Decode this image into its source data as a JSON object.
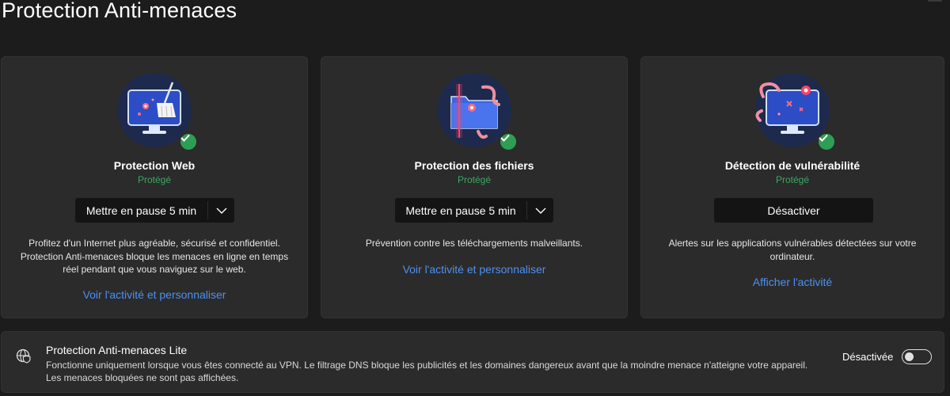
{
  "page": {
    "title": "Protection Anti-menaces"
  },
  "cards": [
    {
      "title": "Protection Web",
      "status": "Protégé",
      "button_label": "Mettre en pause 5 min",
      "description": "Profitez d'un Internet plus agréable, sécurisé et confidentiel. Protection Anti-menaces bloque les menaces en ligne en temps réel pendant que vous naviguez sur le web.",
      "link": "Voir l'activité et personnaliser",
      "icon": "monitor-broom-icon"
    },
    {
      "title": "Protection des fichiers",
      "status": "Protégé",
      "button_label": "Mettre en pause 5 min",
      "description": "Prévention contre les téléchargements malveillants.",
      "link": "Voir l'activité et personnaliser",
      "icon": "folder-scan-icon"
    },
    {
      "title": "Détection de vulnérabilité",
      "status": "Protégé",
      "button_label": "Désactiver",
      "description": "Alertes sur les applications vulnérables détectées sur votre ordinateur.",
      "link": "Afficher l'activité",
      "icon": "monitor-virus-icon"
    }
  ],
  "lite": {
    "title": "Protection Anti-menaces Lite",
    "description": "Fonctionne uniquement lorsque vous êtes connecté au VPN. Le filtrage DNS bloque les publicités et les domaines dangereux avant que la moindre menace n'atteigne votre appareil. Les menaces bloquées ne sont pas affichées.",
    "toggle_label": "Désactivée",
    "toggle_on": false,
    "icon": "globe-shield-icon"
  },
  "colors": {
    "background": "#1c1c1c",
    "card": "#2b2b2b",
    "status_green": "#3aa766",
    "link_blue": "#4d90f0",
    "badge_green": "#2f9e55"
  }
}
